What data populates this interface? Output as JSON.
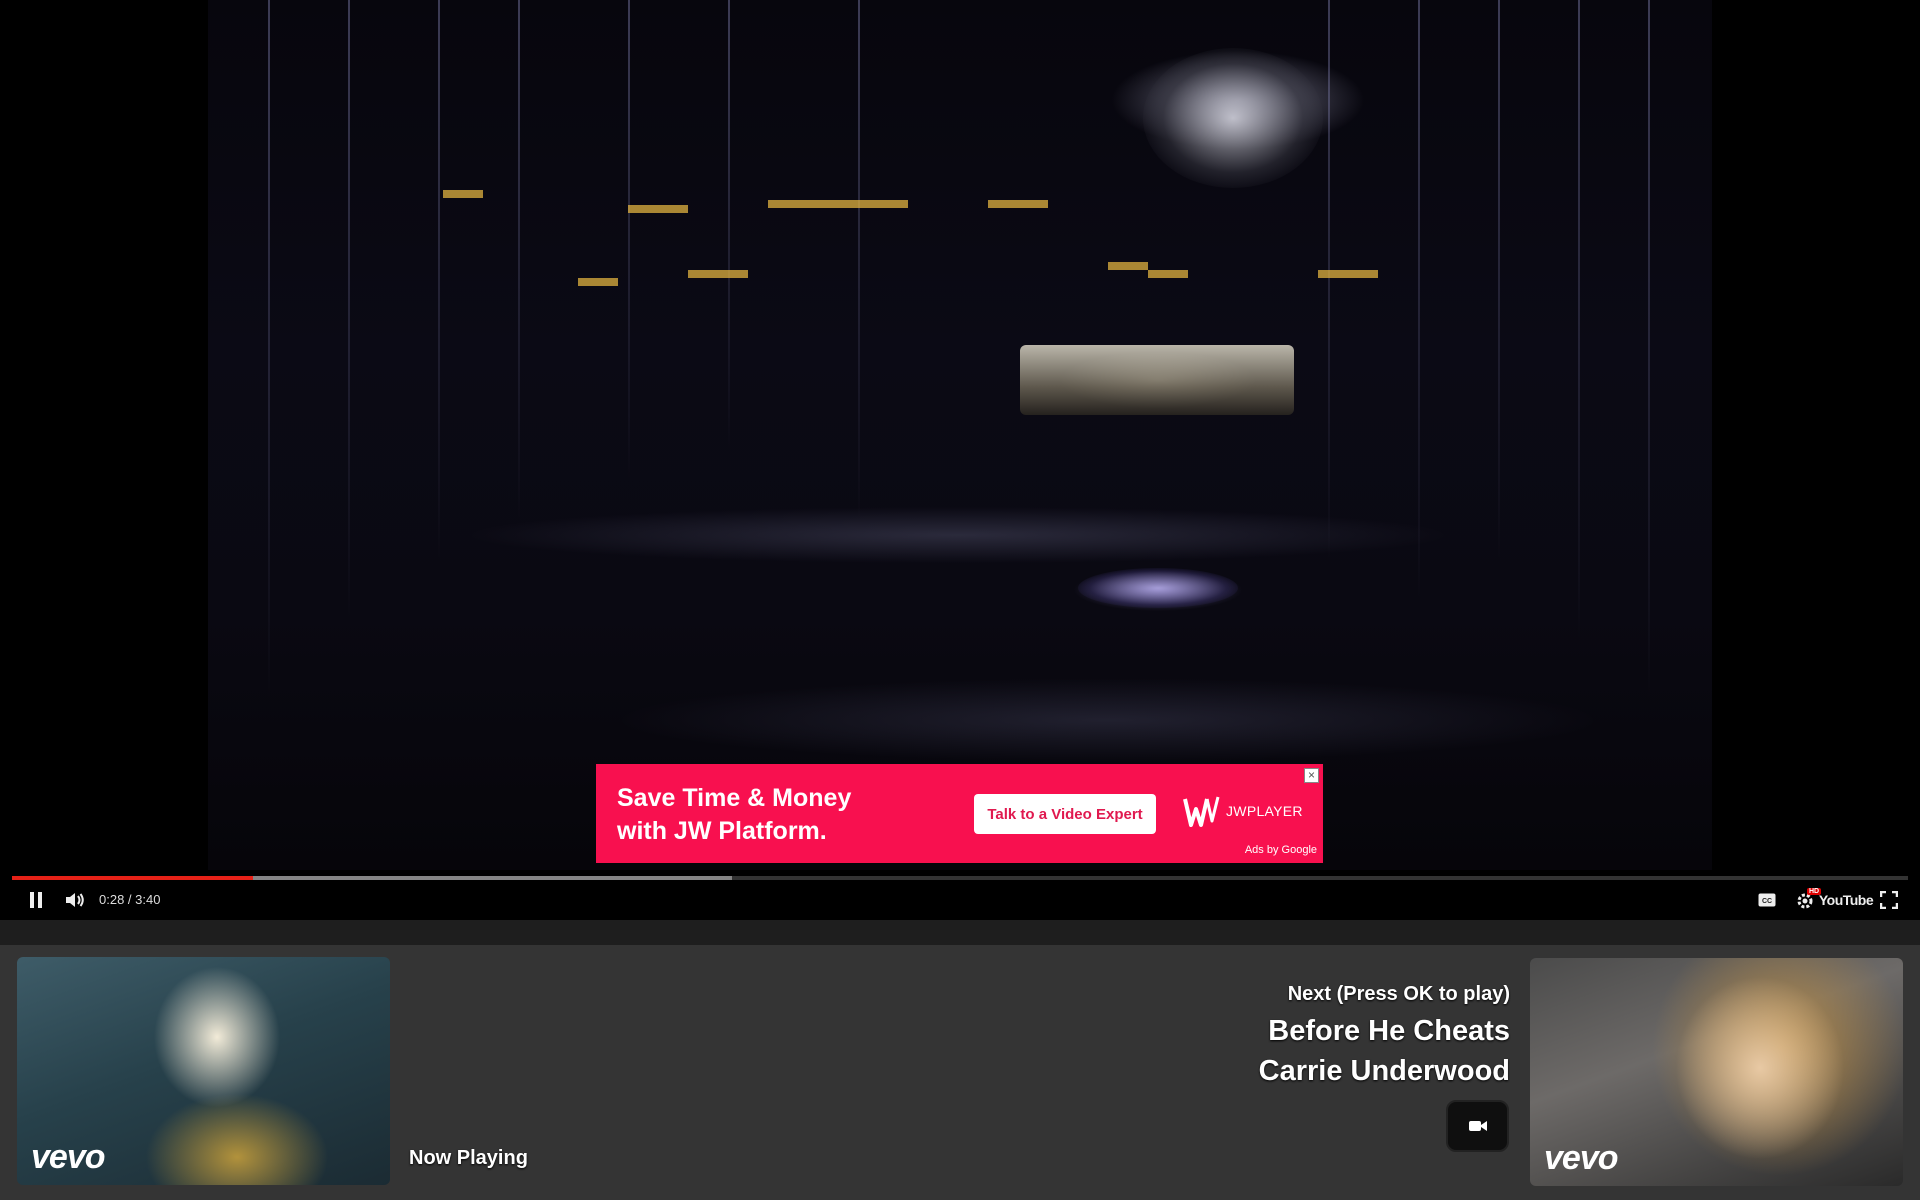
{
  "ad": {
    "headline_line1": "Save Time & Money",
    "headline_line2": "with JW Platform.",
    "cta_label": "Talk to a Video Expert",
    "logo_text": "JWPLAYER",
    "attribution": "Ads by Google",
    "close_label": "×",
    "background_color": "#f8104f"
  },
  "player": {
    "time_display": "0:28 / 3:40",
    "progress_played": 0.127,
    "progress_buffered": 0.38,
    "accent_color": "#e62117",
    "controls": {
      "play_pause": "pause-icon",
      "volume": "volume-icon",
      "captions": "captions-icon",
      "settings": "settings-hd-icon",
      "youtube": "YouTube",
      "fullscreen": "fullscreen-icon"
    },
    "hd_badge": "HD"
  },
  "now_playing": {
    "label": "Now Playing",
    "brand": "vevo"
  },
  "up_next": {
    "label": "Next (Press OK to play)",
    "title": "Before He Cheats",
    "artist": "Carrie Underwood",
    "brand": "vevo",
    "button_icon": "video-camera-icon"
  }
}
